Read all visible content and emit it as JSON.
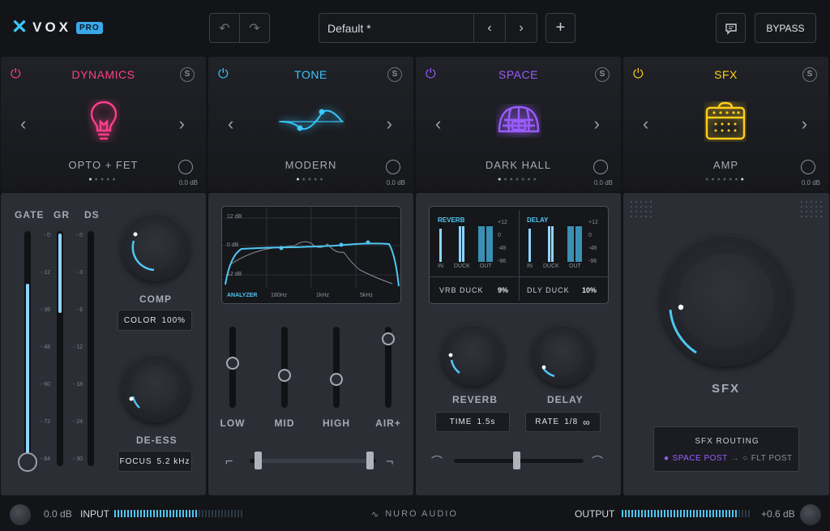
{
  "app": {
    "name": "VOX",
    "badge": "PRO",
    "preset": "Default *",
    "bypass": "BYPASS"
  },
  "icons": {
    "undo": "undo-icon",
    "redo": "redo-icon",
    "prev": "chevron-left-icon",
    "next": "chevron-right-icon",
    "add": "plus-icon",
    "feedback": "chat-icon"
  },
  "modules": [
    {
      "title": "DYNAMICS",
      "color": "#ff3f8c",
      "preset": "OPTO + FET",
      "db": "0.0 dB",
      "dots": "● ● ● ● ●",
      "active_dot": 0
    },
    {
      "title": "TONE",
      "color": "#38c7ff",
      "preset": "MODERN",
      "db": "0.0 dB",
      "dots": "● ● ● ● ●",
      "active_dot": 0
    },
    {
      "title": "SPACE",
      "color": "#9b5cff",
      "preset": "DARK HALL",
      "db": "0.0 dB",
      "dots": "● ● ● ● ● ● ●",
      "active_dot": 0
    },
    {
      "title": "SFX",
      "color": "#ffcf1a",
      "preset": "AMP",
      "db": "0.0 dB",
      "dots": "● ● ● ● ● ● ●",
      "active_dot": 6
    }
  ],
  "solo": "S",
  "dynamics": {
    "meters": [
      "GATE",
      "GR",
      "DS"
    ],
    "scale_a": [
      "0",
      "12",
      "36",
      "48",
      "60",
      "72",
      "84"
    ],
    "scale_b": [
      "0",
      "3",
      "6",
      "12",
      "18",
      "24",
      "30"
    ],
    "comp_label": "COMP",
    "color_label": "COLOR",
    "color_value": "100%",
    "deess_label": "DE-ESS",
    "focus_label": "FOCUS",
    "focus_value": "5.2 kHz"
  },
  "tone": {
    "analyzer": {
      "db_top": "12 dB",
      "db_mid": "0 dB",
      "db_bot": "12 dB",
      "label": "ANALYZER",
      "f1": "180Hz",
      "f2": "1kHz",
      "f3": "5kHz"
    },
    "sliders": [
      {
        "label": "LOW",
        "level": 0.55
      },
      {
        "label": "MID",
        "level": 0.4
      },
      {
        "label": "HIGH",
        "level": 0.35
      },
      {
        "label": "AIR+",
        "level": 0.85
      }
    ]
  },
  "space": {
    "reverb": {
      "title": "REVERB",
      "in": "IN",
      "duck": "DUCK",
      "out": "OUT",
      "duck_label": "VRB DUCK",
      "duck_value": "9%"
    },
    "delay": {
      "title": "DELAY",
      "in": "IN",
      "duck": "DUCK",
      "out": "OUT",
      "duck_label": "DLY DUCK",
      "duck_value": "10%"
    },
    "scale": [
      "+12",
      "0",
      "-48",
      "-96"
    ],
    "reverb_label": "REVERB",
    "time_label": "TIME",
    "time_value": "1.5s",
    "delay_label": "DELAY",
    "rate_label": "RATE",
    "rate_value": "1/8"
  },
  "sfx": {
    "label": "SFX",
    "routing_title": "SFX ROUTING",
    "opt1": "SPACE POST",
    "arrow": "→",
    "opt2": "FLT POST"
  },
  "footer": {
    "input_db": "0.0 dB",
    "input_label": "INPUT",
    "brand": "NURO AUDIO",
    "output_label": "OUTPUT",
    "output_db": "+0.6 dB"
  }
}
